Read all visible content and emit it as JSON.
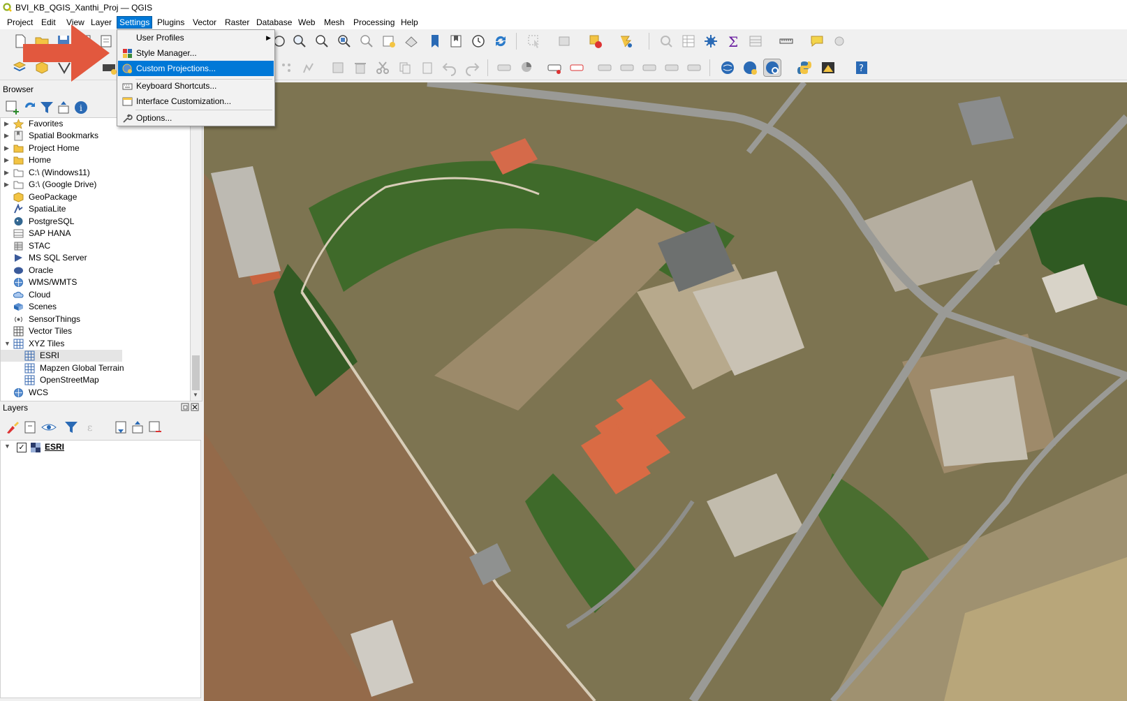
{
  "window": {
    "title": "BVI_KB_QGIS_Xanthi_Proj — QGIS"
  },
  "menubar": {
    "items": [
      "Project",
      "Edit",
      "View",
      "Layer",
      "Settings",
      "Plugins",
      "Vector",
      "Raster",
      "Database",
      "Web",
      "Mesh",
      "Processing",
      "Help"
    ],
    "active": "Settings"
  },
  "settings_menu": {
    "items": [
      {
        "label": "User Profiles",
        "icon": "none",
        "submenu": true
      },
      {
        "label": "Style Manager...",
        "icon": "style-manager-icon"
      },
      {
        "label": "Custom Projections...",
        "icon": "custom-projection-icon",
        "highlighted": true
      },
      {
        "label": "Keyboard Shortcuts...",
        "icon": "keyboard-icon"
      },
      {
        "label": "Interface Customization...",
        "icon": "interface-customization-icon"
      },
      {
        "label": "Options...",
        "icon": "wrench-icon"
      }
    ]
  },
  "browser": {
    "title": "Browser",
    "items": [
      {
        "label": "Favorites",
        "icon": "star-icon",
        "expandable": true
      },
      {
        "label": "Spatial Bookmarks",
        "icon": "bookmark-icon",
        "expandable": true
      },
      {
        "label": "Project Home",
        "icon": "folder-icon",
        "expandable": true
      },
      {
        "label": "Home",
        "icon": "folder-icon",
        "expandable": true
      },
      {
        "label": "C:\\ (Windows11)",
        "icon": "folder-icon",
        "expandable": true
      },
      {
        "label": "G:\\ (Google Drive)",
        "icon": "folder-icon",
        "expandable": true
      },
      {
        "label": "GeoPackage",
        "icon": "geopackage-icon"
      },
      {
        "label": "SpatiaLite",
        "icon": "spatialite-icon"
      },
      {
        "label": "PostgreSQL",
        "icon": "postgresql-icon"
      },
      {
        "label": "SAP HANA",
        "icon": "sap-hana-icon"
      },
      {
        "label": "STAC",
        "icon": "stac-icon"
      },
      {
        "label": "MS SQL Server",
        "icon": "mssql-icon"
      },
      {
        "label": "Oracle",
        "icon": "oracle-icon"
      },
      {
        "label": "WMS/WMTS",
        "icon": "globe-icon"
      },
      {
        "label": "Cloud",
        "icon": "cloud-icon"
      },
      {
        "label": "Scenes",
        "icon": "scenes-icon"
      },
      {
        "label": "SensorThings",
        "icon": "sensorthings-icon"
      },
      {
        "label": "Vector Tiles",
        "icon": "grid-icon"
      },
      {
        "label": "XYZ Tiles",
        "icon": "grid-icon",
        "expanded": true
      },
      {
        "label": "ESRI",
        "icon": "grid-icon",
        "child": true,
        "selected": true
      },
      {
        "label": "Mapzen Global Terrain",
        "icon": "grid-icon",
        "child": true
      },
      {
        "label": "OpenStreetMap",
        "icon": "grid-icon",
        "child": true
      },
      {
        "label": "WCS",
        "icon": "globe-icon"
      }
    ]
  },
  "layers": {
    "title": "Layers",
    "items": [
      {
        "name": "ESRI",
        "checked": true,
        "icon": "raster-tiles-icon"
      }
    ]
  },
  "colors": {
    "accent": "#0078d7",
    "arrow": "#e2583e",
    "map_base": "#7b7350"
  }
}
